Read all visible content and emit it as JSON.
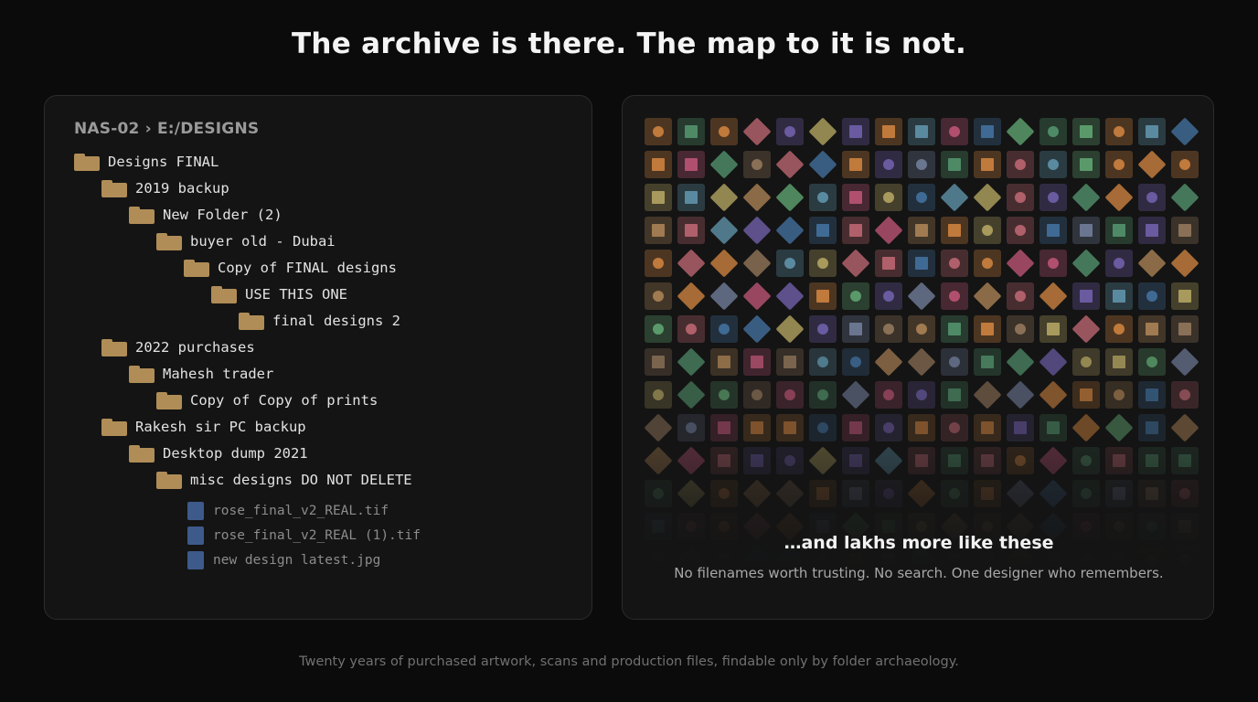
{
  "headline": "The archive is there. The map to it is not.",
  "breadcrumb": "NAS-02 › E:/DESIGNS",
  "tree": [
    {
      "label": "Designs FINAL",
      "depth": 0,
      "type": "folder"
    },
    {
      "label": "2019 backup",
      "depth": 1,
      "type": "folder"
    },
    {
      "label": "New Folder (2)",
      "depth": 2,
      "type": "folder"
    },
    {
      "label": "buyer old - Dubai",
      "depth": 3,
      "type": "folder"
    },
    {
      "label": "Copy of FINAL designs",
      "depth": 4,
      "type": "folder"
    },
    {
      "label": "USE THIS ONE",
      "depth": 5,
      "type": "folder"
    },
    {
      "label": "final designs 2",
      "depth": 6,
      "type": "folder"
    },
    {
      "label": "2022 purchases",
      "depth": 1,
      "type": "folder"
    },
    {
      "label": "Mahesh trader",
      "depth": 2,
      "type": "folder"
    },
    {
      "label": "Copy of Copy of prints",
      "depth": 3,
      "type": "folder"
    },
    {
      "label": "Rakesh sir PC backup",
      "depth": 1,
      "type": "folder"
    },
    {
      "label": "Desktop dump 2021",
      "depth": 2,
      "type": "folder"
    },
    {
      "label": "misc designs DO NOT DELETE",
      "depth": 3,
      "type": "folder"
    },
    {
      "label": "rose_final_v2_REAL.tif",
      "depth": 4,
      "type": "file"
    },
    {
      "label": "rose_final_v2_REAL (1).tif",
      "depth": 4,
      "type": "file"
    },
    {
      "label": "new design latest.jpg",
      "depth": 4,
      "type": "file"
    }
  ],
  "gallery": {
    "title": "…and lakhs more like these",
    "subtitle": "No filenames worth trusting. No search. One designer who remembers.",
    "palette": [
      "#b0606a",
      "#4e8a66",
      "#3f6a94",
      "#a89a5c",
      "#8a7056",
      "#c07a3c",
      "#b0506e",
      "#6a5aa0",
      "#5a8aa0",
      "#6a7590",
      "#a07a50",
      "#5a9a6a"
    ]
  },
  "footer": "Twenty years of purchased artwork, scans and production files, findable only by folder archaeology."
}
